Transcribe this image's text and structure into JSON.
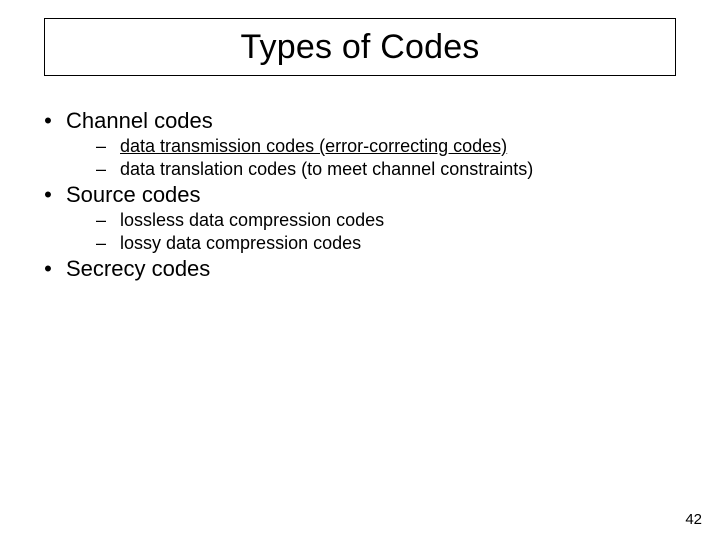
{
  "title": "Types of Codes",
  "bullets": {
    "channel": {
      "label": "Channel codes",
      "sub": {
        "transmission": "data transmission codes (error-correcting codes)",
        "translation": "data translation codes (to meet channel constraints)"
      }
    },
    "source": {
      "label": "Source codes",
      "sub": {
        "lossless": "lossless data compression codes",
        "lossy": "lossy data compression codes"
      }
    },
    "secrecy": {
      "label": "Secrecy codes"
    }
  },
  "glyphs": {
    "bullet": "•",
    "dash": "–"
  },
  "page_number": "42"
}
